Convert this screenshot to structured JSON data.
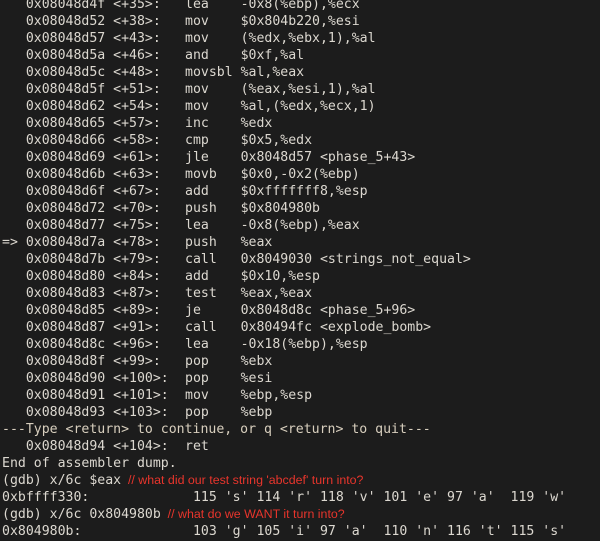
{
  "terminal": {
    "background_color": "#1c1c1c",
    "text_color": "#dcd8d0",
    "annotation_color": "#e8352c",
    "lines": [
      {
        "kind": "asm",
        "text": "   0x08048d4f <+35>:\tlea    -0x8(%ebp),%ecx"
      },
      {
        "kind": "asm",
        "text": "   0x08048d52 <+38>:\tmov    $0x804b220,%esi"
      },
      {
        "kind": "asm",
        "text": "   0x08048d57 <+43>:\tmov    (%edx,%ebx,1),%al"
      },
      {
        "kind": "asm",
        "text": "   0x08048d5a <+46>:\tand    $0xf,%al"
      },
      {
        "kind": "asm",
        "text": "   0x08048d5c <+48>:\tmovsbl %al,%eax"
      },
      {
        "kind": "asm",
        "text": "   0x08048d5f <+51>:\tmov    (%eax,%esi,1),%al"
      },
      {
        "kind": "asm",
        "text": "   0x08048d62 <+54>:\tmov    %al,(%edx,%ecx,1)"
      },
      {
        "kind": "asm",
        "text": "   0x08048d65 <+57>:\tinc    %edx"
      },
      {
        "kind": "asm",
        "text": "   0x08048d66 <+58>:\tcmp    $0x5,%edx"
      },
      {
        "kind": "asm",
        "text": "   0x08048d69 <+61>:\tjle    0x8048d57 <phase_5+43>"
      },
      {
        "kind": "asm",
        "text": "   0x08048d6b <+63>:\tmovb   $0x0,-0x2(%ebp)"
      },
      {
        "kind": "asm",
        "text": "   0x08048d6f <+67>:\tadd    $0xfffffff8,%esp"
      },
      {
        "kind": "asm",
        "text": "   0x08048d72 <+70>:\tpush   $0x804980b"
      },
      {
        "kind": "asm",
        "text": "   0x08048d77 <+75>:\tlea    -0x8(%ebp),%eax"
      },
      {
        "kind": "asm",
        "text": "=> 0x08048d7a <+78>:\tpush   %eax"
      },
      {
        "kind": "asm",
        "text": "   0x08048d7b <+79>:\tcall   0x8049030 <strings_not_equal>"
      },
      {
        "kind": "asm",
        "text": "   0x08048d80 <+84>:\tadd    $0x10,%esp"
      },
      {
        "kind": "asm",
        "text": "   0x08048d83 <+87>:\ttest   %eax,%eax"
      },
      {
        "kind": "asm",
        "text": "   0x08048d85 <+89>:\tje     0x8048d8c <phase_5+96>"
      },
      {
        "kind": "asm",
        "text": "   0x08048d87 <+91>:\tcall   0x80494fc <explode_bomb>"
      },
      {
        "kind": "asm",
        "text": "   0x08048d8c <+96>:\tlea    -0x18(%ebp),%esp"
      },
      {
        "kind": "asm",
        "text": "   0x08048d8f <+99>:\tpop    %ebx"
      },
      {
        "kind": "asm",
        "text": "   0x08048d90 <+100>:\tpop    %esi"
      },
      {
        "kind": "asm",
        "text": "   0x08048d91 <+101>:\tmov    %ebp,%esp"
      },
      {
        "kind": "asm",
        "text": "   0x08048d93 <+103>:\tpop    %ebp"
      },
      {
        "kind": "pager",
        "text": "---Type <return> to continue, or q <return> to quit---"
      },
      {
        "kind": "asm",
        "text": "   0x08048d94 <+104>:\tret"
      },
      {
        "kind": "output",
        "text": "End of assembler dump."
      },
      {
        "kind": "prompt",
        "text": "(gdb) x/6c $eax",
        "comment": "// what did our test string 'abcdef' turn into?"
      },
      {
        "kind": "output",
        "text": "0xbffff330:\t 115 's' 114 'r' 118 'v' 101 'e' 97 'a'  119 'w'"
      },
      {
        "kind": "prompt",
        "text": "(gdb) x/6c 0x804980b",
        "comment": "// what do we WANT it turn into?"
      },
      {
        "kind": "output",
        "text": "0x804980b:\t 103 'g' 105 'i' 97 'a'  110 'n' 116 't' 115 's'"
      }
    ]
  }
}
